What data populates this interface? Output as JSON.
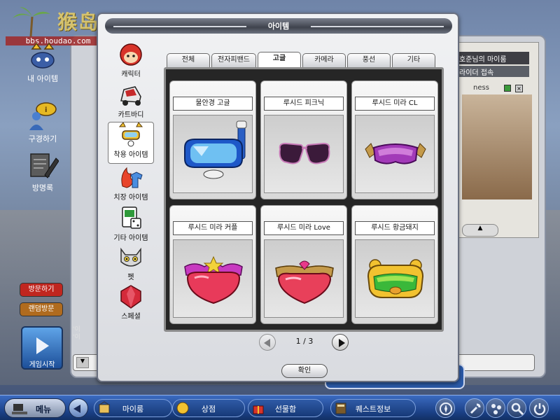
{
  "watermark": {
    "logo": "猴岛",
    "url": "bbs.houdao.com"
  },
  "left_nav": {
    "items": [
      {
        "label": "내 아이템",
        "icon": "item-bag-icon"
      },
      {
        "label": "구경하기",
        "icon": "browse-person-icon"
      },
      {
        "label": "방명록",
        "icon": "guestbook-pencil-icon"
      }
    ],
    "visit_button": "방문하기",
    "random_visit_button": "랜덤방문",
    "start_button": "게임시작"
  },
  "background": {
    "room_title": "호준님의 마이룸",
    "rider_status": "라이더 접속",
    "partial_text": "ness",
    "chat_lines": [
      "'이",
      "'이"
    ]
  },
  "modal": {
    "title": "아이템",
    "categories": [
      {
        "label": "캐릭터",
        "icon": "character-face-icon",
        "active": false
      },
      {
        "label": "카트바디",
        "icon": "kart-body-icon",
        "active": false
      },
      {
        "label": "착용 아이템",
        "icon": "wear-item-icon",
        "active": true
      },
      {
        "label": "치장 아이템",
        "icon": "decoration-flame-shirt-icon",
        "active": false
      },
      {
        "label": "기타 아이템",
        "icon": "card-dice-icon",
        "active": false
      },
      {
        "label": "펫",
        "icon": "cat-pet-icon",
        "active": false
      },
      {
        "label": "스페셜",
        "icon": "red-gem-icon",
        "active": false
      }
    ],
    "tabs": [
      {
        "label": "전체",
        "active": false
      },
      {
        "label": "전자피밴드",
        "active": false
      },
      {
        "label": "고글",
        "active": true
      },
      {
        "label": "카메라",
        "active": false
      },
      {
        "label": "풍선",
        "active": false
      },
      {
        "label": "기타",
        "active": false
      }
    ],
    "items": [
      {
        "name": "물안경 고글",
        "icon": "snorkel-goggle-icon"
      },
      {
        "name": "루시드 피크닉",
        "icon": "sunglasses-icon"
      },
      {
        "name": "루시드 미라 CL",
        "icon": "pink-visor-goggle-icon"
      },
      {
        "name": "루시드 미라 커플",
        "icon": "heart-star-goggle-icon"
      },
      {
        "name": "루시드 미라 Love",
        "icon": "heart-love-goggle-icon"
      },
      {
        "name": "루시드 황금돼지",
        "icon": "golden-pig-goggle-icon"
      }
    ],
    "pagination": {
      "current": "1",
      "total": "3",
      "text": "1 / 3"
    },
    "confirm_button": "확인"
  },
  "taskbar": {
    "menu": "메뉴",
    "buttons": [
      {
        "label": "마이룸",
        "icon": "myroom-icon"
      },
      {
        "label": "상점",
        "icon": "shop-coin-icon"
      },
      {
        "label": "선물함",
        "icon": "gift-box-icon"
      },
      {
        "label": "퀘스트정보",
        "icon": "quest-book-icon"
      }
    ],
    "right_icons": [
      "compass-icon",
      "wrench-icon",
      "network-icon",
      "magnifier-icon",
      "power-icon"
    ]
  },
  "colors": {
    "visit": "#c0261f",
    "random_visit": "#b06b1e",
    "taskbar": "#1a3f84",
    "grid_bg": "#262626"
  }
}
